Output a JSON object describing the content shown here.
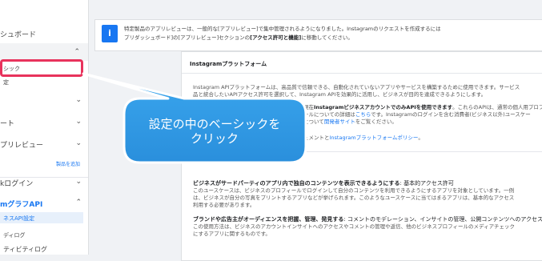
{
  "sidebar": {
    "dashboard": "シュボード",
    "basic": "シック",
    "settings_partial": "定",
    "item_a": "",
    "item_b": "ート",
    "item_c": "プリレビュー",
    "add_product": "製品を追加",
    "login": "kログイン",
    "graph_api": "mグラフAPI",
    "api_settings": "ネスAPI設定",
    "sub1": "ディログ",
    "sub2": "ティビティログ"
  },
  "notice": {
    "line1": "特定製品のアプリレビューは、一般的な[アプリレビュー]で集中管理されるようになりました。Instagramのリクエストを作成するには",
    "line2_a": "プリダッシュボード]の[アプリレビュー]セクションの",
    "line2_b": "[アクセス許可と機能]",
    "line2_c": "に移動してください。"
  },
  "platform": {
    "title": "Instagramプラットフォーム",
    "p1_l1": "Instagram APIプラットフォームは、高品質で信頼できる、自動化されていないアプリやサービスを構築するために使用できます。サービス",
    "p1_l2": "品と統合したいAPIアクセス許可を選択して、Instagram APIを効果的に活用し、ビジネスが目的を達成できるようにします。",
    "p2_l1_a": "現在",
    "p2_l1_b": "InstagramビジネスアカウントでのみAPIを使用できます",
    "p2_l1_c": "。これらのAPIは、通常の個人用プロフ",
    "p2_l2_a": "ールについての詳細は",
    "p2_l2_b": "こちら",
    "p2_l2_c": "です。Instagramのログインを含む消費者(ビジネス以外)ユースケー",
    "p2_l3_a": "について",
    "p2_l3_b": "開発者サイト",
    "p2_l3_c": "をご覧ください。",
    "p3_a": "ュメントと",
    "p3_b": "Instagramプラットフォームポリシー",
    "p3_c": "。",
    "s1_title_a": "ビジネスがサードパーティのアプリ内で独自のコンテンツを表示できるようにする",
    "s1_title_b": ": 基本的アクセス許可",
    "s1_l1": "このユースケースは、ビジネスのプロフィールでログインして自分のコンテンツを利用できるようにするアプリを対象としています。一例",
    "s1_l2": "は、ビジネスが自分の写真をプリントするアプリなどが挙げられます。このようなユースケースに当てはまるアプリは、基本的なアクセス",
    "s1_l3": "利用する必要があります。",
    "s2_title_a": "ブランドや広告主がオーディエンスを把握、管理、発見する",
    "s2_title_b": ": コメントのモデレーション、インサイトの管理、公開コンテンツへのアクセス",
    "s2_l1": "この使用方法は、ビジネスのアカウントインサイトへのアクセスやコメントの管理や返信、他のビジネスプロフィールのメディアチェック",
    "s2_l2": "にするアプリに関するものです。"
  },
  "callout": {
    "line1": "設定の中のベーシックを",
    "line2": "クリック"
  },
  "colors": {
    "accent": "#1877f2",
    "highlight": "#e8335c",
    "callout": "#2f9be6"
  }
}
